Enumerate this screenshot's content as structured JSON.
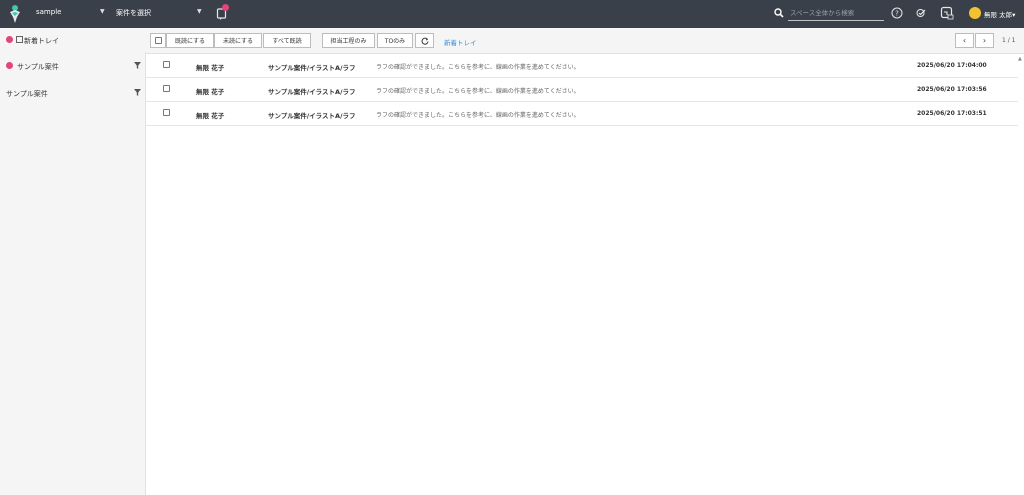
{
  "header": {
    "space_name": "sample",
    "project_select": "案件を選択",
    "search_placeholder": "スペース全体から検索",
    "user_name": "無限 太郎",
    "colors": {
      "bar": "#3a4049",
      "accent": "#e0457b",
      "avatar": "#f2c230"
    }
  },
  "sidebar": {
    "items": [
      {
        "label": "新着トレイ",
        "dot": true
      },
      {
        "label": "サンプル案件",
        "dot": true
      },
      {
        "label": "サンプル案件",
        "dot": false
      }
    ]
  },
  "toolbar": {
    "mark_read": "既読にする",
    "mark_unread": "未読にする",
    "mark_all_read": "すべて既読",
    "my_process_only": "担当工程のみ",
    "to_only": "TOのみ",
    "inbox_link": "新着トレイ",
    "page_info": "1 / 1"
  },
  "messages": [
    {
      "sender": "無限 花子",
      "project": "サンプル案件/イラストA/ラフ",
      "text": "ラフの確認ができました。こちらを参考に、線画の作業を進めてください。",
      "date": "2025/06/20 17:04:00"
    },
    {
      "sender": "無限 花子",
      "project": "サンプル案件/イラストA/ラフ",
      "text": "ラフの確認ができました。こちらを参考に、線画の作業を進めてください。",
      "date": "2025/06/20 17:03:56"
    },
    {
      "sender": "無限 花子",
      "project": "サンプル案件/イラストA/ラフ",
      "text": "ラフの確認ができました。こちらを参考に、線画の作業を進めてください。",
      "date": "2025/06/20 17:03:51"
    }
  ]
}
